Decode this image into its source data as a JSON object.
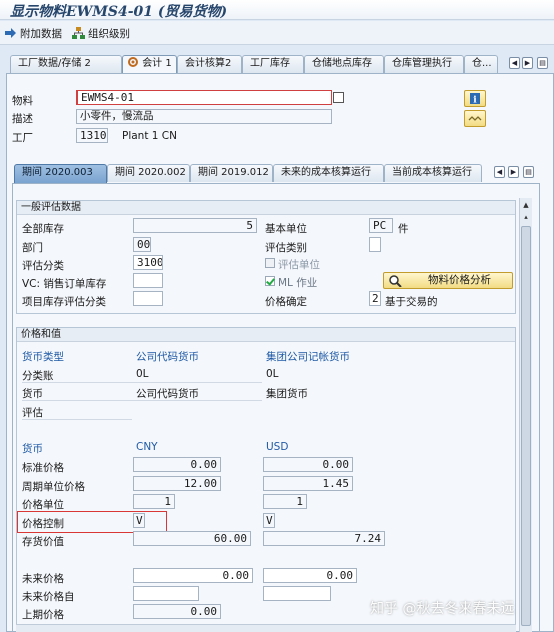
{
  "window": {
    "title": "显示物料EWMS4-01 (贸易货物)"
  },
  "toolbar": {
    "additional_data": "附加数据",
    "org_levels": "组织级别"
  },
  "view_tabs": [
    {
      "label": "工厂数据/存储 2"
    },
    {
      "label": "会计 1"
    },
    {
      "label": "会计核算2"
    },
    {
      "label": "工厂库存"
    },
    {
      "label": "仓储地点库存"
    },
    {
      "label": "仓库管理执行"
    },
    {
      "label": "仓..."
    }
  ],
  "header": {
    "material_label": "物料",
    "material_value": "EWMS4-01",
    "desc_label": "描述",
    "desc_value": "小零件，慢流品",
    "plant_label": "工厂",
    "plant_value": "1310",
    "plant_name": "Plant 1 CN"
  },
  "period_tabs": [
    {
      "label": "期间 2020.003"
    },
    {
      "label": "期间 2020.002"
    },
    {
      "label": "期间 2019.012"
    },
    {
      "label": "未来的成本核算运行"
    },
    {
      "label": "当前成本核算运行"
    }
  ],
  "general_valuation": {
    "title": "一般评估数据",
    "total_stock_label": "全部库存",
    "total_stock_value": "5",
    "base_unit_label": "基本单位",
    "base_unit_value": "PC",
    "base_unit_text": "件",
    "division_label": "部门",
    "division_value": "00",
    "valuation_cat_label": "评估类别",
    "valuation_cat_value": "",
    "valuation_class_label": "评估分类",
    "valuation_class_value": "3100",
    "valuation_unit_label": "评估单位",
    "vc_label": "VC: 销售订单库存",
    "vc_value": "",
    "ml_label": "ML 作业",
    "price_analysis_label": "物料价格分析",
    "proj_stock_label": "项目库存评估分类",
    "proj_stock_value": "",
    "price_det_label": "价格确定",
    "price_det_value": "2",
    "price_det_text": "基于交易的"
  },
  "prices_values": {
    "title": "价格和值",
    "currency_type_label": "货币类型",
    "col1_type": "公司代码货币",
    "col2_type": "集团公司记帐货币",
    "ledger_label": "分类账",
    "ledger_col1": "0L",
    "ledger_col2": "0L",
    "currency_label": "货币",
    "currency_col1": "公司代码货币",
    "currency_col2": "集团货币",
    "valuation_label": "评估",
    "curr_label": "货币",
    "curr_col1": "CNY",
    "curr_col2": "USD",
    "std_price_label": "标准价格",
    "std_price_col1": "0.00",
    "std_price_col2": "0.00",
    "per_unit_price_label": "周期单位价格",
    "per_unit_price_col1": "12.00",
    "per_unit_price_col2": "1.45",
    "price_unit_label": "价格单位",
    "price_unit_col1": "1",
    "price_unit_col2": "1",
    "price_control_label": "价格控制",
    "price_control_col1": "V",
    "price_control_col2": "V",
    "stock_value_label": "存货价值",
    "stock_value_col1": "60.00",
    "stock_value_col2": "7.24",
    "future_price_label": "未来价格",
    "future_price_col1": "0.00",
    "future_price_col2": "0.00",
    "future_price_from_label": "未来价格自",
    "prev_price_label": "上期价格",
    "prev_price_col1": "0.00"
  },
  "watermark": "知乎 @秋去冬来春未远",
  "colors": {
    "highlight": "#d93636",
    "link_blue": "#1f5aa6",
    "tab_active": "#7aa3d0"
  }
}
